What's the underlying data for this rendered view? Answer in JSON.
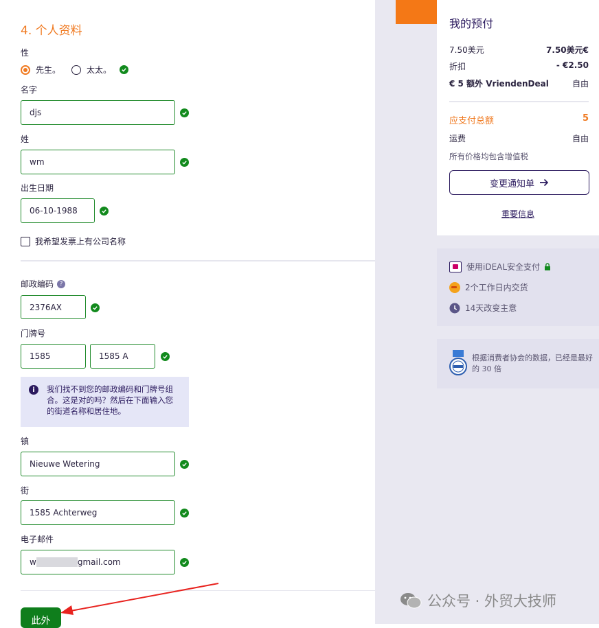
{
  "section": {
    "title": "4. 个人资料"
  },
  "gender": {
    "label": "性",
    "option_mr": "先生。",
    "option_mrs": "太太。"
  },
  "first_name": {
    "label": "名字",
    "value": "djs"
  },
  "last_name": {
    "label": "姓",
    "value": "wm"
  },
  "dob": {
    "label": "出生日期",
    "value": "06-10-1988"
  },
  "company_checkbox": {
    "label": "我希望发票上有公司名称"
  },
  "postcode": {
    "label": "邮政编码",
    "value": "2376AX"
  },
  "house_number": {
    "label": "门牌号",
    "value": "1585",
    "addition": "1585 A"
  },
  "info_notice": {
    "text": "我们找不到您的邮政编码和门牌号组合。这是对的吗？然后在下面输入您的街道名称和居住地。"
  },
  "town": {
    "label": "镇",
    "value": "Nieuwe Wetering"
  },
  "street": {
    "label": "街",
    "value": "1585 Achterweg"
  },
  "email": {
    "label": "电子邮件",
    "value_prefix": "w",
    "value_suffix": "gmail.com"
  },
  "submit": {
    "label": "此外"
  },
  "summary": {
    "title": "我的预付",
    "rows": [
      {
        "label": "7.50美元",
        "value": "7.50美元€"
      },
      {
        "label": "折扣",
        "value": "- €2.50"
      },
      {
        "label": "€ 5 额外 VriendenDeal",
        "value": "自由"
      }
    ],
    "total_label": "应支付总额",
    "total_value": "5",
    "shipping_label": "运费",
    "shipping_value": "自由",
    "vat_note": "所有价格均包含增值税",
    "change_button": "变更通知单",
    "important_link": "重要信息"
  },
  "benefits": [
    {
      "icon": "ideal-icon",
      "text": "使用iDEAL安全支付"
    },
    {
      "icon": "postnl-icon",
      "text": "2个工作日内交货"
    },
    {
      "icon": "clock-icon",
      "text": "14天改变主意"
    }
  ],
  "rating": {
    "text": "根据消费者协会的数据，已经是最好的 30 倍"
  },
  "watermark": {
    "text": "公众号 · 外贸大技师"
  },
  "colors": {
    "accent": "#f07a21",
    "success": "#128a1d",
    "purple": "#2b1a5e"
  }
}
